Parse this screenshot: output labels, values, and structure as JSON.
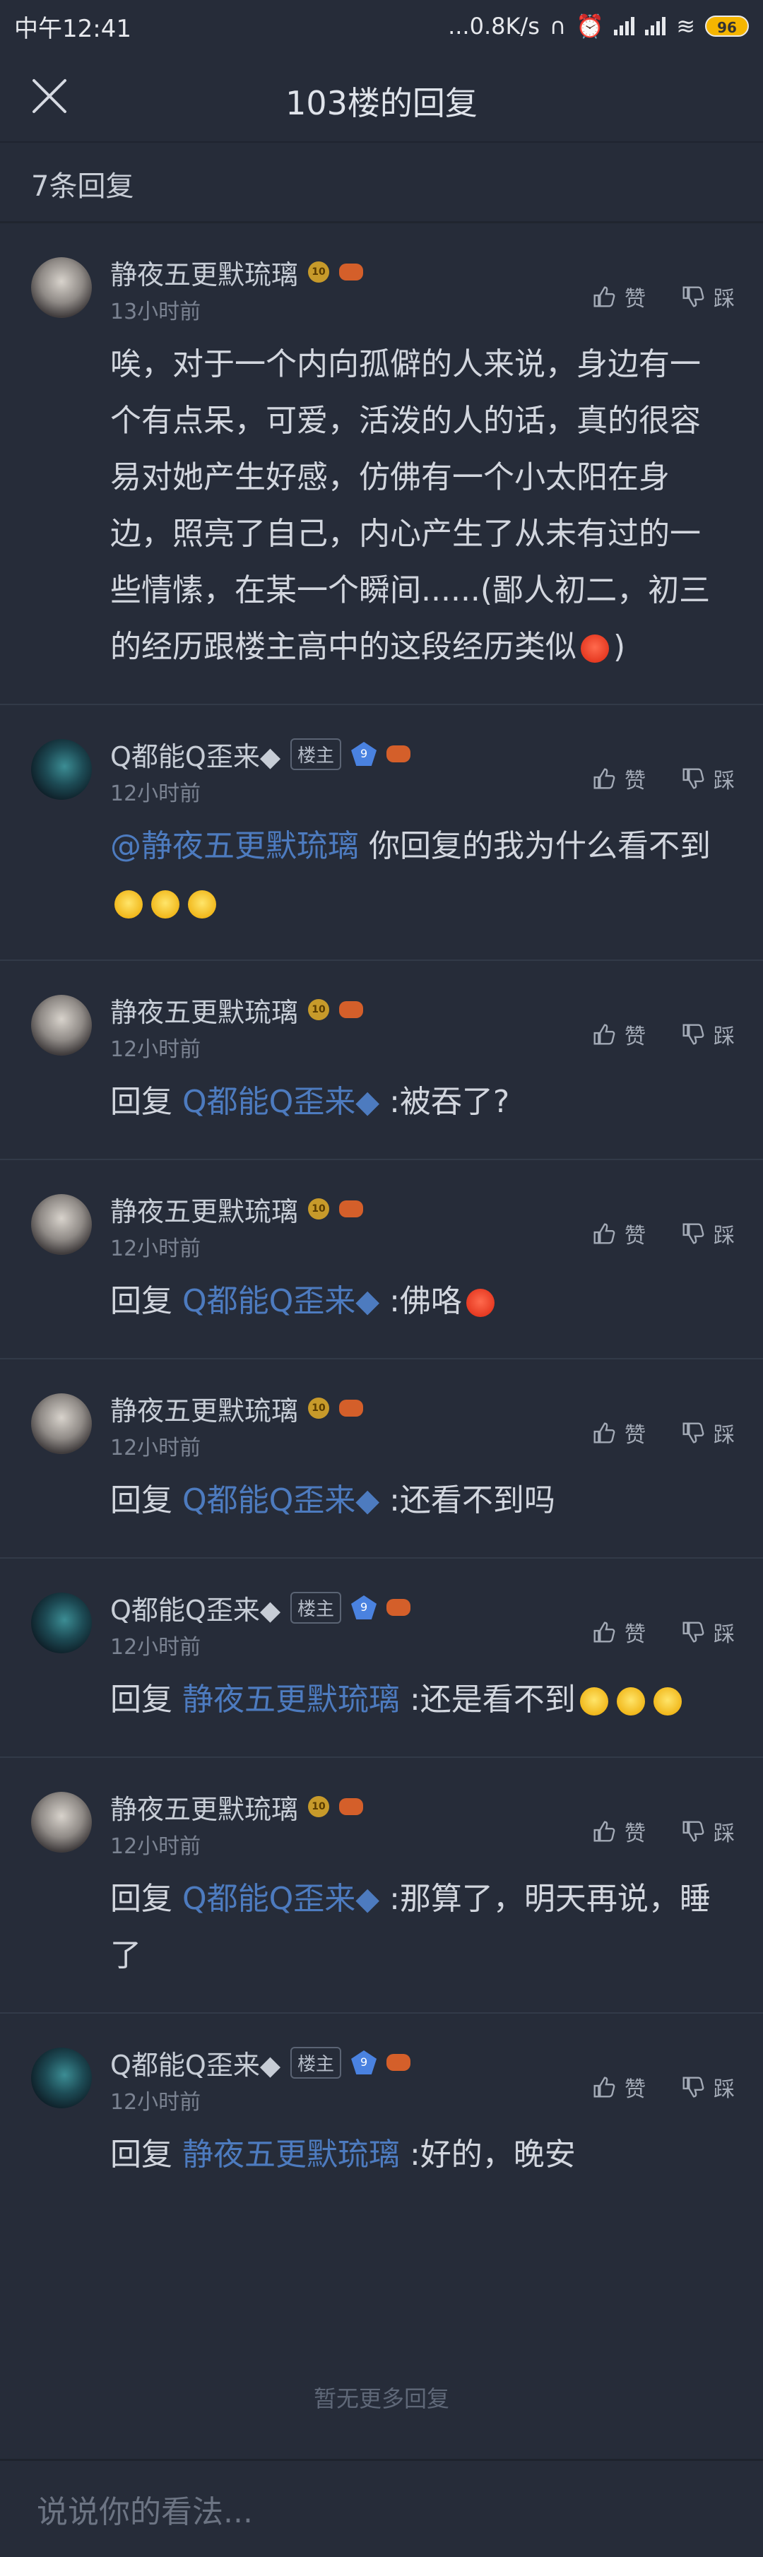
{
  "status_bar": {
    "time": "中午12:41",
    "network_speed": "...0.8K/s",
    "battery": "96"
  },
  "header": {
    "title": "103楼的回复"
  },
  "reply_count": "7条回复",
  "actions": {
    "like": "赞",
    "dislike": "踩"
  },
  "comments": [
    {
      "name": "静夜五更默琉璃",
      "time": "13小时前",
      "text": "唉，对于一个内向孤僻的人来说，身边有一个有点呆，可爱，活泼的人的话，真的很容易对她产生好感，仿佛有一个小太阳在身边，照亮了自己，内心产生了从未有过的一些情愫，在某一个瞬间......(鄙人初二，初三的经历跟楼主高中的这段经历类似",
      "text_end": ")"
    },
    {
      "name": "Q都能Q歪来◆",
      "owner_badge": "楼主",
      "vip_level": "9",
      "time": "12小时前",
      "mention": "@静夜五更默琉璃",
      "text": " 你回复的我为什么看不到"
    },
    {
      "name": "静夜五更默琉璃",
      "time": "12小时前",
      "reply_prefix": "回复 ",
      "mention": "Q都能Q歪来◆",
      "text": " :被吞了?"
    },
    {
      "name": "静夜五更默琉璃",
      "time": "12小时前",
      "reply_prefix": "回复 ",
      "mention": "Q都能Q歪来◆",
      "text": " :佛咯"
    },
    {
      "name": "静夜五更默琉璃",
      "time": "12小时前",
      "reply_prefix": "回复 ",
      "mention": "Q都能Q歪来◆",
      "text": " :还看不到吗"
    },
    {
      "name": "Q都能Q歪来◆",
      "owner_badge": "楼主",
      "vip_level": "9",
      "time": "12小时前",
      "reply_prefix": "回复 ",
      "mention": "静夜五更默琉璃",
      "text": " :还是看不到"
    },
    {
      "name": "静夜五更默琉璃",
      "time": "12小时前",
      "reply_prefix": "回复 ",
      "mention": "Q都能Q歪来◆",
      "text": " :那算了，明天再说，睡了"
    },
    {
      "name": "Q都能Q歪来◆",
      "owner_badge": "楼主",
      "vip_level": "9",
      "time": "12小时前",
      "reply_prefix": "回复 ",
      "mention": "静夜五更默琉璃",
      "text": " :好的，晚安"
    }
  ],
  "level_badge": "10",
  "no_more": "暂无更多回复",
  "input_placeholder": "说说你的看法..."
}
